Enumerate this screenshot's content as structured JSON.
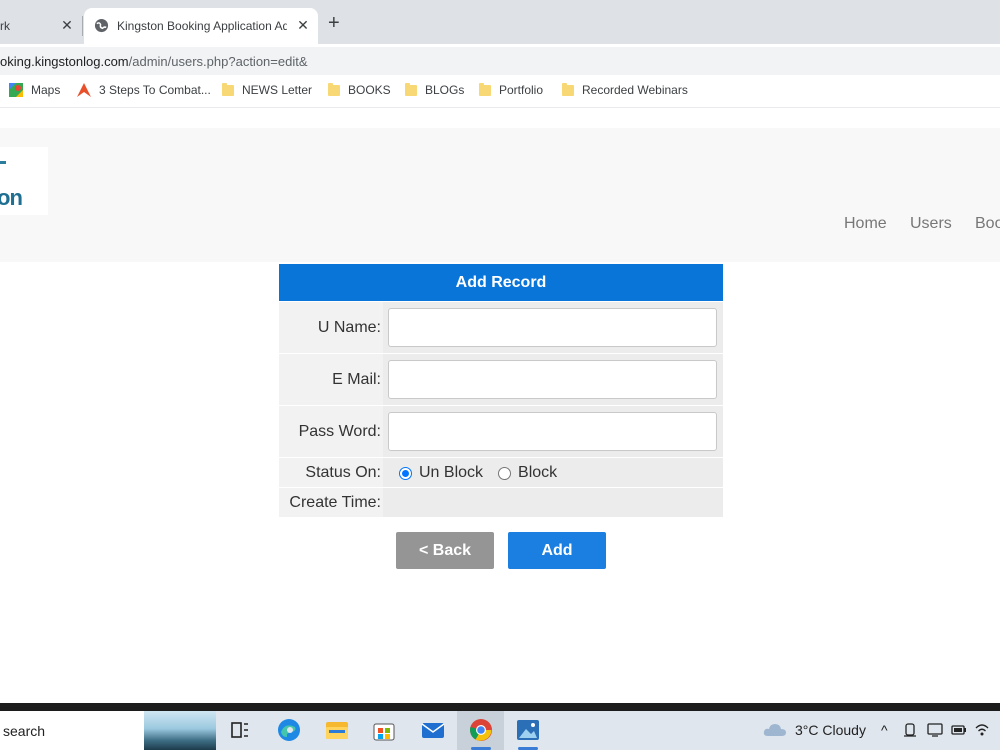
{
  "browser": {
    "tabs": [
      {
        "title": "rk",
        "active": false
      },
      {
        "title": "Kingston Booking Application Ad",
        "active": true
      }
    ],
    "url": {
      "host": "oking.kingstonlog.com",
      "path": "/admin/users.php?action=edit&"
    },
    "bookmarks": [
      {
        "label": "Maps",
        "icon": "maps-icon"
      },
      {
        "label": "3 Steps To Combat...",
        "icon": "arrow-logo-icon"
      },
      {
        "label": "NEWS Letter",
        "icon": "folder-icon"
      },
      {
        "label": "BOOKS",
        "icon": "folder-icon"
      },
      {
        "label": "BLOGs",
        "icon": "folder-icon"
      },
      {
        "label": "Portfolio",
        "icon": "folder-icon"
      },
      {
        "label": "Recorded Webinars",
        "icon": "folder-icon"
      }
    ]
  },
  "site": {
    "logo_text": "on",
    "nav": [
      "Home",
      "Users",
      "Boo"
    ]
  },
  "form": {
    "title": "Add Record",
    "fields": [
      {
        "label": "U Name:",
        "value": "",
        "type": "text"
      },
      {
        "label": "E Mail:",
        "value": "",
        "type": "text"
      },
      {
        "label": "Pass Word:",
        "value": "",
        "type": "password"
      }
    ],
    "status": {
      "label": "Status On:",
      "options": [
        "Un Block",
        "Block"
      ],
      "selected": "Un Block"
    },
    "create_time": {
      "label": "Create Time:",
      "value": ""
    },
    "buttons": {
      "back": "< Back",
      "add": "Add"
    }
  },
  "taskbar": {
    "search_text": "search",
    "weather": "3°C  Cloudy",
    "pinned": [
      "task-view-icon",
      "edge-icon",
      "file-explorer-icon",
      "store-icon",
      "mail-icon",
      "chrome-icon",
      "photos-icon"
    ]
  }
}
